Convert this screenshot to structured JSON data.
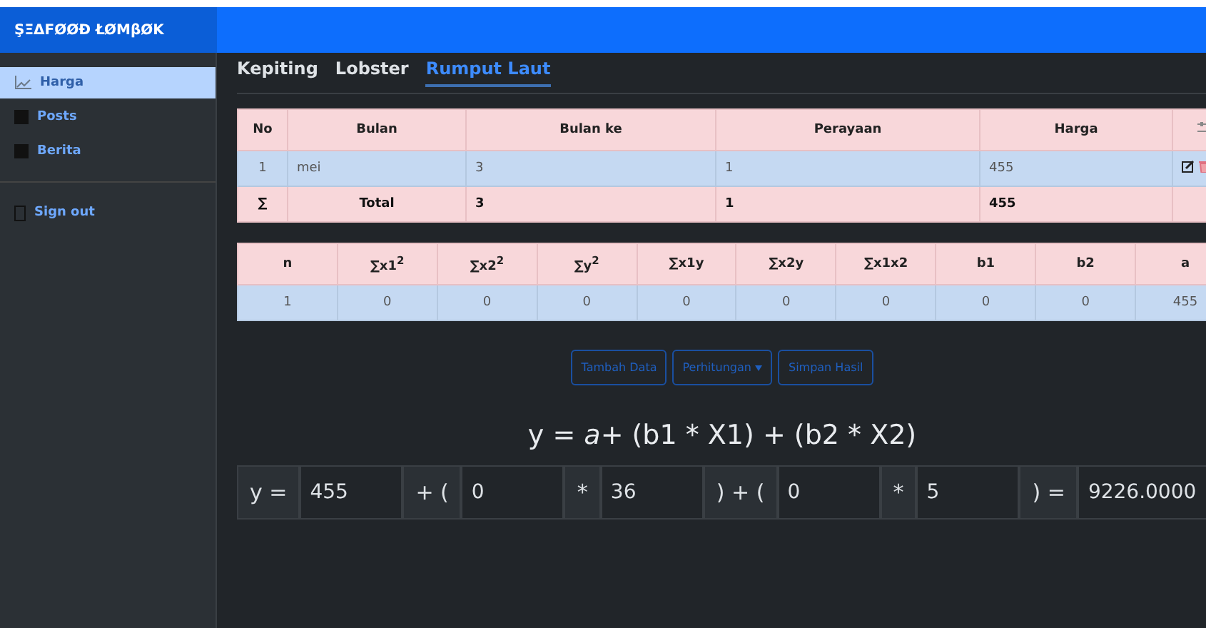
{
  "brand": "ŞΞΔFØØĐ ŁØMβØK",
  "sidebar": {
    "items": [
      {
        "label": "Harga",
        "kind": "chart",
        "selected": true
      },
      {
        "label": "Posts",
        "kind": "square",
        "selected": false
      },
      {
        "label": "Berita",
        "kind": "square",
        "selected": false
      }
    ],
    "footer_items": [
      {
        "label": "Sign out",
        "kind": "door"
      }
    ]
  },
  "tabs": [
    {
      "label": "Kepiting",
      "selected": false
    },
    {
      "label": "Lobster",
      "selected": false
    },
    {
      "label": "Rumput Laut",
      "selected": true
    }
  ],
  "data_table": {
    "columns": [
      "No",
      "Bulan",
      "Bulan ke",
      "Perayaan",
      "Harga"
    ],
    "rows": [
      [
        "1",
        "mei",
        "3",
        "1",
        "455"
      ]
    ],
    "total": [
      "∑",
      "Total",
      "3",
      "1",
      "455"
    ]
  },
  "stats_table": {
    "columns": [
      "n",
      "∑x1$^{2}$",
      "∑x2$^{2}$",
      "∑y$^{2}$",
      "∑x1y",
      "∑x2y",
      "∑x1x2",
      "b1",
      "b2",
      "a"
    ],
    "rows": [
      [
        "1",
        "0",
        "0",
        "0",
        "0",
        "0",
        "0",
        "0",
        "0",
        "455"
      ]
    ]
  },
  "buttons": [
    {
      "label": "Tambah Data",
      "kind": "plain"
    },
    {
      "label": "Perhitungan",
      "kind": "dropdown"
    },
    {
      "label": "Simpan Hasil",
      "kind": "plain"
    }
  ],
  "formula": "y = *a*+ (b1 * X1) + (b2 * X2)",
  "equation": [
    {
      "kind": "label",
      "text": "y ="
    },
    {
      "kind": "input",
      "value": "455"
    },
    {
      "kind": "label",
      "text": "+ ("
    },
    {
      "kind": "input",
      "value": "0"
    },
    {
      "kind": "label",
      "text": "*"
    },
    {
      "kind": "input",
      "value": "36"
    },
    {
      "kind": "label",
      "text": ") + ("
    },
    {
      "kind": "input",
      "value": "0"
    },
    {
      "kind": "label",
      "text": "*"
    },
    {
      "kind": "input",
      "value": "5"
    },
    {
      "kind": "label",
      "text": ") ="
    },
    {
      "kind": "input",
      "value": "9226.0000"
    }
  ]
}
